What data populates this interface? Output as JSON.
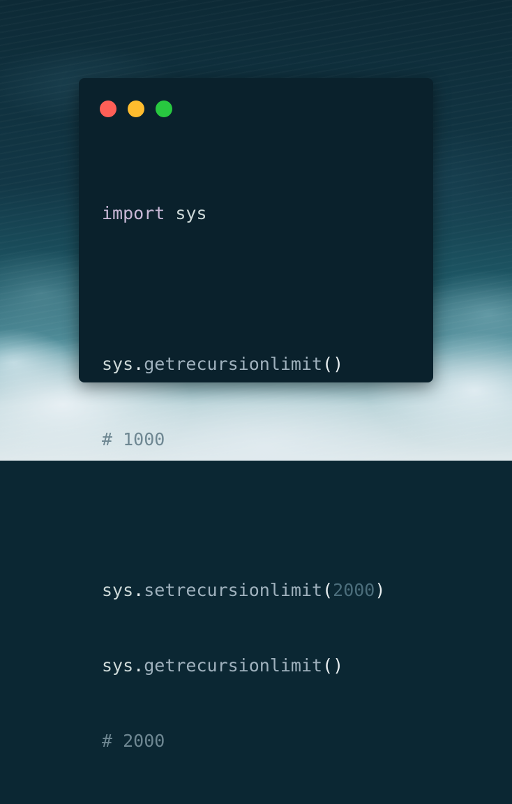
{
  "window": {
    "controls": [
      {
        "name": "close",
        "color": "#ff5f57"
      },
      {
        "name": "minimize",
        "color": "#febc2e"
      },
      {
        "name": "maximize",
        "color": "#28c840"
      }
    ]
  },
  "code": {
    "line1": {
      "keyword": "import",
      "space": " ",
      "module": "sys"
    },
    "line3": {
      "obj": "sys",
      "dot": ".",
      "func": "getrecursionlimit",
      "parens": "()"
    },
    "line4": {
      "comment": "# 1000"
    },
    "line6": {
      "obj": "sys",
      "dot": ".",
      "func": "setrecursionlimit",
      "open": "(",
      "arg": "2000",
      "close": ")"
    },
    "line7": {
      "obj": "sys",
      "dot": ".",
      "func": "getrecursionlimit",
      "parens": "()"
    },
    "line8": {
      "comment": "# 2000"
    }
  }
}
